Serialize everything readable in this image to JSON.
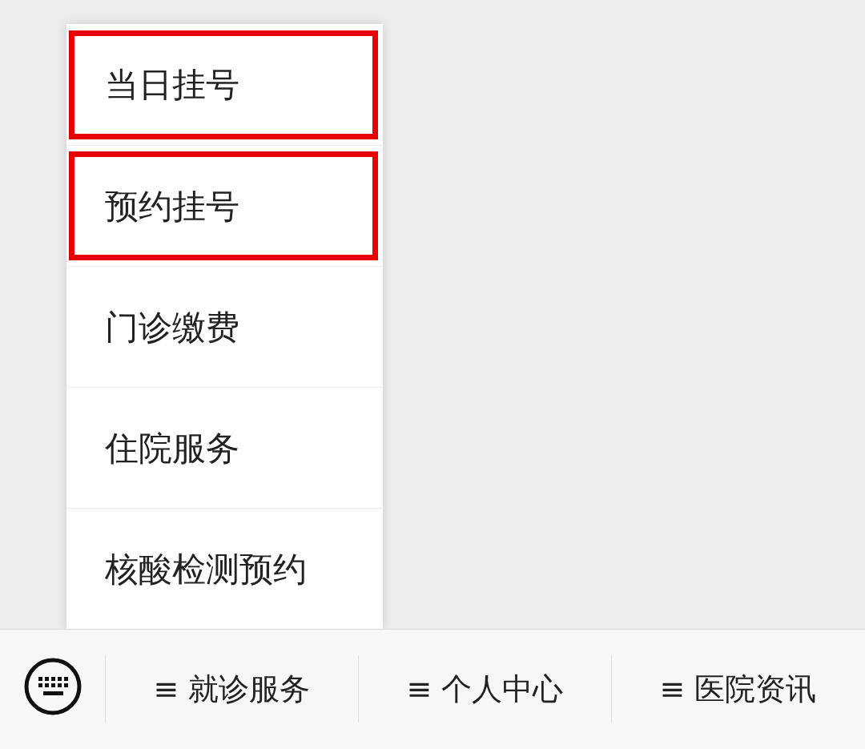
{
  "popup_menu": {
    "items": [
      {
        "label": "当日挂号",
        "highlighted": true
      },
      {
        "label": "预约挂号",
        "highlighted": true
      },
      {
        "label": "门诊缴费",
        "highlighted": false
      },
      {
        "label": "住院服务",
        "highlighted": false
      },
      {
        "label": "核酸检测预约",
        "highlighted": false
      }
    ]
  },
  "bottom_menu": {
    "tabs": [
      {
        "label": "≡ 就诊服务"
      },
      {
        "label": "≡ 个人中心"
      },
      {
        "label": "≡ 医院资讯"
      }
    ]
  }
}
